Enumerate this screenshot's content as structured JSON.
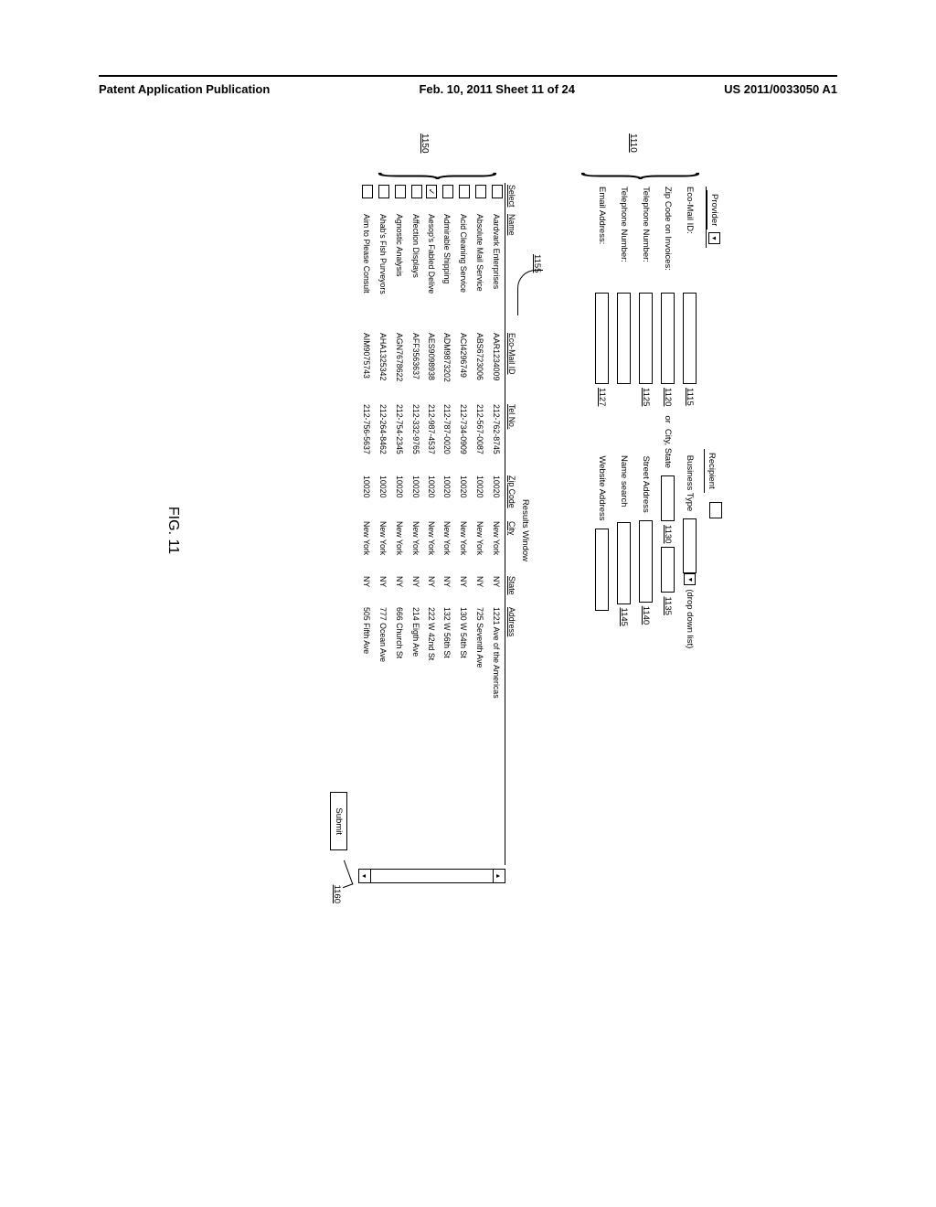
{
  "header": {
    "left": "Patent Application Publication",
    "center": "Feb. 10, 2011  Sheet 11 of 24",
    "right": "US 2011/0033050 A1"
  },
  "tabs": {
    "provider": "Provider",
    "recipient": "Recipient"
  },
  "refs": {
    "r1110": "1110",
    "r1115": "1115",
    "r1120": "1120",
    "r1125": "1125",
    "r1127": "1127",
    "r1130": "1130",
    "r1135": "1135",
    "r1140": "1140",
    "r1145": "1145",
    "r1150": "1150",
    "r1155": "1155",
    "r1160": "1160"
  },
  "labels": {
    "ecoMailId": "Eco-Mail ID:",
    "zipOnInvoices": "Zip Code on Invoices:",
    "telephone": "Telephone Number:",
    "telephone2": "Telephone Number:",
    "emailAddress": "Email Address:",
    "businessType": "Business Type",
    "dropdownNote": "(drop down list)",
    "orCityState": "or  City, State",
    "streetAddress": "Street Address",
    "nameSearch": "Name search",
    "websiteAddress": "Website Address",
    "resultsWindow": "Results Window",
    "submit": "Submit",
    "or": "or"
  },
  "columns": {
    "select": "Select",
    "name": "Name",
    "eco": "Eco-Mail ID",
    "tel": "Tel No.",
    "zip": "Zip Code",
    "city": "City",
    "state": "State",
    "address": "Address"
  },
  "rows": [
    {
      "sel": "",
      "name": "Aardvark Enterprises",
      "eco": "AAR1234009",
      "tel": "212-762-8745",
      "zip": "10020",
      "city": "New York",
      "state": "NY",
      "addr": "1221 Ave of the Americas"
    },
    {
      "sel": "",
      "name": "Absolute Mail Service",
      "eco": "ABS6723006",
      "tel": "212-567-0087",
      "zip": "10020",
      "city": "New York",
      "state": "NY",
      "addr": "725 Seventh Ave"
    },
    {
      "sel": "",
      "name": "Acid Cleaning Service",
      "eco": "ACI4296749",
      "tel": "212-734-0909",
      "zip": "10020",
      "city": "New York",
      "state": "NY",
      "addr": "130 W 54th St"
    },
    {
      "sel": "",
      "name": "Admirable Shipping",
      "eco": "ADM9873202",
      "tel": "212-787-0020",
      "zip": "10020",
      "city": "New York",
      "state": "NY",
      "addr": "132 W 56th St"
    },
    {
      "sel": "✓",
      "name": "Aesop's Fabled Delive",
      "eco": "AES9098938",
      "tel": "212-987-4537",
      "zip": "10020",
      "city": "New York",
      "state": "NY",
      "addr": "222 W 42nd St"
    },
    {
      "sel": "",
      "name": "Affection Displays",
      "eco": "AFF3563637",
      "tel": "212-332-9765",
      "zip": "10020",
      "city": "New York",
      "state": "NY",
      "addr": "214 Eigth Ave"
    },
    {
      "sel": "",
      "name": "Agnostic Analysis",
      "eco": "AGN7678622",
      "tel": "212-754-2345",
      "zip": "10020",
      "city": "New York",
      "state": "NY",
      "addr": "666 Church St"
    },
    {
      "sel": "",
      "name": "Ahab's Fish Purveyors",
      "eco": "AHA1325342",
      "tel": "212-264-8462",
      "zip": "10020",
      "city": "New York",
      "state": "NY",
      "addr": "777 Ocean Ave"
    },
    {
      "sel": "",
      "name": "Aim to Please Consult",
      "eco": "AIM9075743",
      "tel": "212-756-5637",
      "zip": "10020",
      "city": "New York",
      "state": "NY",
      "addr": "505 Fifth Ave"
    }
  ],
  "figure": "FIG. 11"
}
